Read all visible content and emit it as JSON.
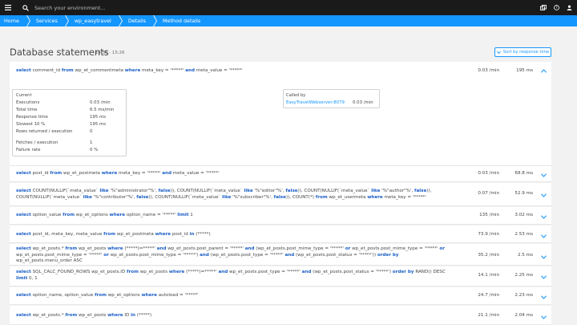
{
  "topbar": {
    "search_placeholder": "Search your environment...",
    "icons": [
      "menu-icon",
      "search-icon",
      "windows-icon",
      "help-icon",
      "user-icon"
    ]
  },
  "breadcrumb": {
    "items": [
      "Home",
      "Services",
      "wp_easytravel",
      "Details",
      "Method details"
    ]
  },
  "header": {
    "title": "Database statements",
    "timeframe": "14:56 - 15:26",
    "sort_button": "Sort by response time"
  },
  "statements": [
    {
      "tokens": [
        [
          "k",
          "select"
        ],
        [
          "t",
          " comment_id "
        ],
        [
          "k",
          "from"
        ],
        [
          "t",
          " wp_et_commentmeta "
        ],
        [
          "k",
          "where"
        ],
        [
          "t",
          " meta_key = '*****' "
        ],
        [
          "k",
          "and"
        ],
        [
          "t",
          " meta_value = '*****'"
        ]
      ],
      "rate": "0.03 /min",
      "time": "195 ms",
      "expanded": true
    },
    {
      "tokens": [
        [
          "k",
          "select"
        ],
        [
          "t",
          " post_id "
        ],
        [
          "k",
          "from"
        ],
        [
          "t",
          " wp_et_postmeta "
        ],
        [
          "k",
          "where"
        ],
        [
          "t",
          " meta_key = '*****' "
        ],
        [
          "k",
          "and"
        ],
        [
          "t",
          " meta_value = '*****'"
        ]
      ],
      "rate": "0.03 /min",
      "time": "68.8 ms"
    },
    {
      "tokens": [
        [
          "k",
          "select"
        ],
        [
          "t",
          " COUNT(NULLIF(`meta_value` "
        ],
        [
          "k",
          "like"
        ],
        [
          "t",
          " '%\"administrator\"%', "
        ],
        [
          "k",
          "false"
        ],
        [
          "t",
          ")), COUNT(NULLIF(`meta_value` "
        ],
        [
          "k",
          "like"
        ],
        [
          "t",
          " '%\"editor\"%', "
        ],
        [
          "k",
          "false"
        ],
        [
          "t",
          ")), COUNT(NULLIF(`meta_value` "
        ],
        [
          "k",
          "like"
        ],
        [
          "t",
          " '%\"author\"%', "
        ],
        [
          "k",
          "false"
        ],
        [
          "t",
          ")), COUNT(NULLIF(`meta_value` "
        ],
        [
          "k",
          "like"
        ],
        [
          "t",
          " '%\"contributor\"%', "
        ],
        [
          "k",
          "false"
        ],
        [
          "t",
          ")), COUNT(NULLIF(`meta_value` "
        ],
        [
          "k",
          "like"
        ],
        [
          "t",
          " '%\"subscriber\"%', "
        ],
        [
          "k",
          "false"
        ],
        [
          "t",
          ")), COUNT(*) "
        ],
        [
          "k",
          "from"
        ],
        [
          "t",
          " wp_et_usermeta "
        ],
        [
          "k",
          "where"
        ],
        [
          "t",
          " meta_key = '*****'"
        ]
      ],
      "rate": "0.07 /min",
      "time": "52.9 ms"
    },
    {
      "tokens": [
        [
          "k",
          "select"
        ],
        [
          "t",
          " option_value "
        ],
        [
          "k",
          "from"
        ],
        [
          "t",
          " wp_et_options "
        ],
        [
          "k",
          "where"
        ],
        [
          "t",
          " option_name = '*****' "
        ],
        [
          "k",
          "limit"
        ],
        [
          "t",
          " 1"
        ]
      ],
      "rate": "135 /min",
      "time": "3.02 ms"
    },
    {
      "tokens": [
        [
          "k",
          "select"
        ],
        [
          "t",
          " post_id, meta_key, meta_value "
        ],
        [
          "k",
          "from"
        ],
        [
          "t",
          " wp_et_postmeta "
        ],
        [
          "k",
          "where"
        ],
        [
          "t",
          " post_id "
        ],
        [
          "k",
          "in"
        ],
        [
          "t",
          " (*****)"
        ]
      ],
      "rate": "73.9 /min",
      "time": "2.53 ms"
    },
    {
      "tokens": [
        [
          "k",
          "select"
        ],
        [
          "t",
          " wp_et_posts.* "
        ],
        [
          "k",
          "from"
        ],
        [
          "t",
          " wp_et_posts "
        ],
        [
          "k",
          "where"
        ],
        [
          "t",
          " (*****)=*****' "
        ],
        [
          "k",
          "and"
        ],
        [
          "t",
          " wp_et_posts.post_parent = '*****' "
        ],
        [
          "k",
          "and"
        ],
        [
          "t",
          " (wp_et_posts.post_mime_type = '*****' "
        ],
        [
          "k",
          "or"
        ],
        [
          "t",
          " wp_et_posts.post_mime_type = '*****' "
        ],
        [
          "k",
          "or"
        ],
        [
          "t",
          " wp_et_posts.post_mime_type = '*****' "
        ],
        [
          "k",
          "or"
        ],
        [
          "t",
          " wp_et_posts.post_mime_type = '*****') "
        ],
        [
          "k",
          "and"
        ],
        [
          "t",
          " (wp_et_posts.post_type = '*****' "
        ],
        [
          "k",
          "and"
        ],
        [
          "t",
          " (wp_et_posts.post_status = '*****')) "
        ],
        [
          "k",
          "order by"
        ],
        [
          "t",
          " wp_et_posts.menu_order ASC"
        ]
      ],
      "rate": "35.2 /min",
      "time": "2.5 ms"
    },
    {
      "tokens": [
        [
          "k",
          "select"
        ],
        [
          "t",
          " SQL_CALC_FOUND_ROWS wp_et_posts.ID "
        ],
        [
          "k",
          "from"
        ],
        [
          "t",
          " wp_et_posts "
        ],
        [
          "k",
          "where"
        ],
        [
          "t",
          " (*****)=*****' "
        ],
        [
          "k",
          "and"
        ],
        [
          "t",
          " wp_et_posts.post_type = '*****' "
        ],
        [
          "k",
          "and"
        ],
        [
          "t",
          " (wp_et_posts.post_status = '*****') "
        ],
        [
          "k",
          "order by"
        ],
        [
          "t",
          " RAND() DESC "
        ],
        [
          "k",
          "limit"
        ],
        [
          "t",
          " 0, 1"
        ]
      ],
      "rate": "14.1 /min",
      "time": "2.25 ms"
    },
    {
      "tokens": [
        [
          "k",
          "select"
        ],
        [
          "t",
          " option_name, option_value "
        ],
        [
          "k",
          "from"
        ],
        [
          "t",
          " wp_et_options "
        ],
        [
          "k",
          "where"
        ],
        [
          "t",
          " autoload = '*****'"
        ]
      ],
      "rate": "24.7 /min",
      "time": "2.23 ms"
    },
    {
      "tokens": [
        [
          "k",
          "select"
        ],
        [
          "t",
          " wp_et_posts.* "
        ],
        [
          "k",
          "from"
        ],
        [
          "t",
          " wp_et_posts "
        ],
        [
          "k",
          "where"
        ],
        [
          "t",
          " ID "
        ],
        [
          "k",
          "in"
        ],
        [
          "t",
          " (*****)"
        ]
      ],
      "rate": "21.1 /min",
      "time": "2.04 ms"
    }
  ],
  "details": {
    "title": "Current",
    "rows": [
      {
        "label": "Executions",
        "value": "0.03 /min"
      },
      {
        "label": "Total time",
        "value": "6.5 ms/min"
      },
      {
        "label": "Response time",
        "value": "195 ms"
      },
      {
        "label": "Slowest 10 %",
        "value": "195 ms"
      },
      {
        "label": "Rows returned / execution",
        "value": "0"
      },
      {
        "label": "Fetches / execution",
        "value": "1"
      },
      {
        "label": "Failure rate",
        "value": "0 %"
      }
    ]
  },
  "called_by": {
    "title": "Called by",
    "link": "EasyTravelWebserver:8079",
    "rate": "0.03 /min"
  },
  "colors": {
    "accent": "#1496ff",
    "topbar": "#1a1a1a",
    "keyword": "#1a5ec6"
  }
}
